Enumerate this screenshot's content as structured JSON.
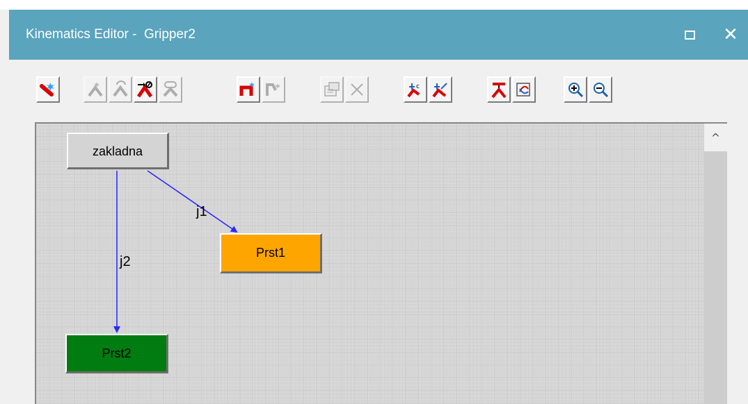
{
  "window": {
    "title": "Kinematics Editor -  Gripper2",
    "maximize_icon": "maximize-icon",
    "close_glyph": "✕"
  },
  "toolbar": {
    "groups": [
      [
        "create-link-icon"
      ],
      [
        "create-revolute-joint-icon",
        "create-prismatic-joint-icon",
        "create-joint-icon",
        "create-chain-joint-icon"
      ],
      [
        "create-crank-icon",
        "crank-properties-icon"
      ],
      [
        "properties-icon",
        "delete-icon"
      ],
      [
        "set-tcp-frame-icon",
        "set-base-frame-icon"
      ],
      [
        "joint-jog-icon",
        "refresh-icon"
      ],
      [
        "zoom-in-icon",
        "zoom-out-icon"
      ]
    ]
  },
  "canvas": {
    "nodes": {
      "base": {
        "label": "zakladna",
        "color": "#d4d4d4"
      },
      "prst1": {
        "label": "Prst1",
        "color": "#ffa500"
      },
      "prst2": {
        "label": "Prst2",
        "color": "#007c11"
      }
    },
    "edges": {
      "j1": {
        "label": "j1",
        "from": "zakladna",
        "to": "Prst1"
      },
      "j2": {
        "label": "j2",
        "from": "zakladna",
        "to": "Prst2"
      }
    },
    "edge_color": "#2a2aff"
  },
  "scrollbar": {
    "up_glyph": "^"
  }
}
